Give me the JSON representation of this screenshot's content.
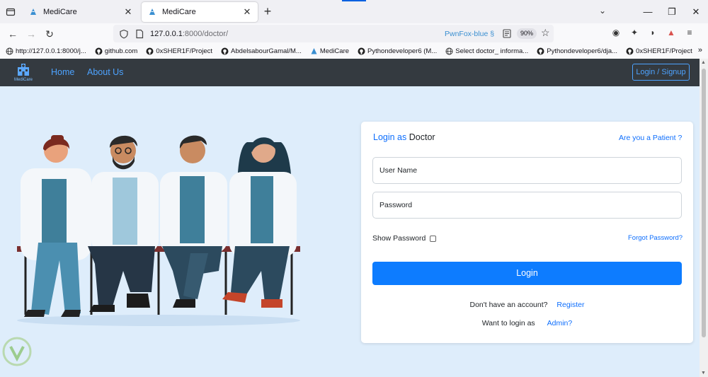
{
  "browser": {
    "tabs": [
      {
        "title": "MediCare",
        "active": false
      },
      {
        "title": "MediCare",
        "active": true
      }
    ],
    "url_host": "127.0.0.1",
    "url_path": ":8000/doctor/",
    "container_label": "PwnFox-blue",
    "zoom": "90%",
    "bookmarks": [
      {
        "label": "http://127.0.0.1:8000/j...",
        "icon": "globe-icon"
      },
      {
        "label": "github.com",
        "icon": "github-icon"
      },
      {
        "label": "0xSHER1F/Project",
        "icon": "github-icon"
      },
      {
        "label": "AbdelsabourGamal/M...",
        "icon": "github-icon"
      },
      {
        "label": "MediCare",
        "icon": "medicare-icon"
      },
      {
        "label": "Pythondeveloper6 (M...",
        "icon": "github-icon"
      },
      {
        "label": "Select doctor_ informa...",
        "icon": "globe-icon"
      },
      {
        "label": "Pythondeveloper6/dja...",
        "icon": "github-icon"
      },
      {
        "label": "0xSHER1F/Project",
        "icon": "github-icon"
      }
    ]
  },
  "site": {
    "brand": "MediCare",
    "nav": {
      "home": "Home",
      "about": "About Us"
    },
    "auth_button": "Login / Signup"
  },
  "login": {
    "title_prefix": "Login as",
    "title_role": "Doctor",
    "patient_link": "Are you a Patient ?",
    "username_placeholder": "User Name",
    "password_placeholder": "Password",
    "show_password": "Show Password",
    "forgot_password": "Forgot Password?",
    "submit": "Login",
    "no_account": "Don't have an account?",
    "register": "Register",
    "login_as": "Want to login as",
    "admin": "Admin?"
  },
  "colors": {
    "page_bg": "#deedfb",
    "navbar_bg": "#343a40",
    "primary": "#0d7cff",
    "link": "#4da3ff"
  }
}
